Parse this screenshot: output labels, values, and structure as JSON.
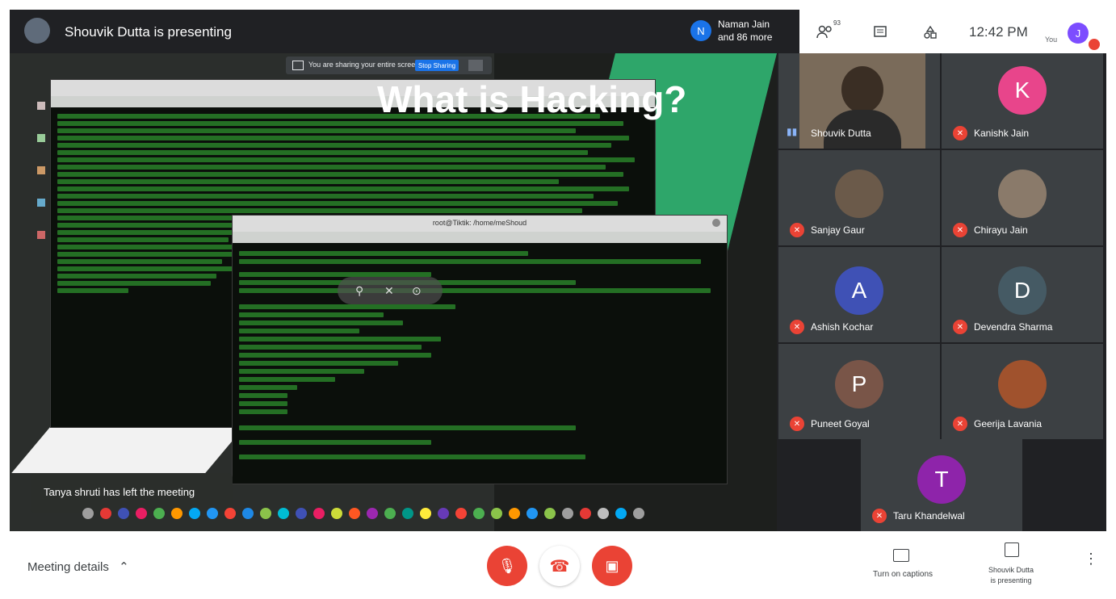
{
  "header": {
    "presenting_text": "Shouvik Dutta is presenting",
    "participants_text": "Naman Jain\nand 86 more",
    "participants_initial": "N",
    "participants_count_badge": "93",
    "time": "12:42 PM",
    "you_label": "You",
    "me_initial": "J"
  },
  "share_banner": {
    "text": "You are sharing your entire screen",
    "stop_label": "Stop Sharing"
  },
  "slide": {
    "title": "What is Hacking?"
  },
  "terminal": {
    "title": "root@Tiktik: /home/meShoud"
  },
  "notification": {
    "text": "Tanya shruti has left the meeting"
  },
  "participants": [
    {
      "name": "Shouvik Dutta",
      "initial": "",
      "color": "#7a6b5a",
      "muted": false,
      "video": true
    },
    {
      "name": "Kanishk Jain",
      "initial": "K",
      "color": "#e8458b",
      "muted": true
    },
    {
      "name": "Sanjay Gaur",
      "initial": "",
      "color": "#6b5a4a",
      "muted": true
    },
    {
      "name": "Chirayu Jain",
      "initial": "",
      "color": "#8a7a6a",
      "muted": true
    },
    {
      "name": "Ashish Kochar",
      "initial": "A",
      "color": "#3f51b5",
      "muted": true
    },
    {
      "name": "Devendra Sharma",
      "initial": "D",
      "color": "#455a64",
      "muted": true
    },
    {
      "name": "Puneet Goyal",
      "initial": "P",
      "color": "#795548",
      "muted": true
    },
    {
      "name": "Geerija Lavania",
      "initial": "",
      "color": "#a0522d",
      "muted": true
    },
    {
      "name": "Taru Khandelwal",
      "initial": "T",
      "color": "#8e24aa",
      "muted": true
    }
  ],
  "bottom": {
    "meeting_details": "Meeting details",
    "captions_label": "Turn on captions",
    "present_label_line1": "Shouvik Dutta",
    "present_label_line2": "is presenting"
  },
  "colors": {
    "red_control": "#ea4335",
    "slide_green": "#2ea66a",
    "meet_bg": "#202124"
  }
}
